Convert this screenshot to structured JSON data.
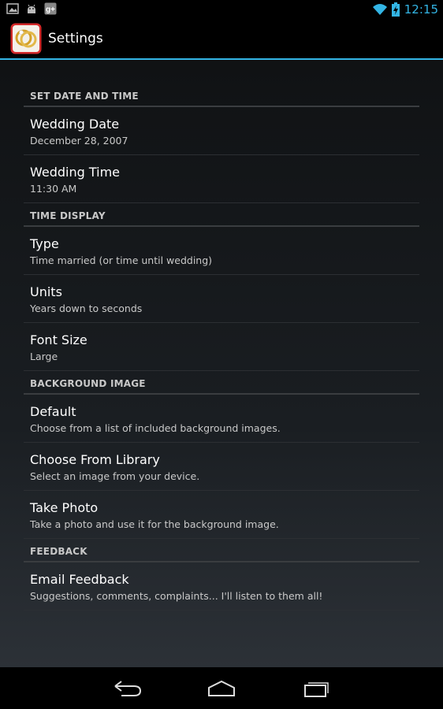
{
  "status_bar": {
    "time": "12:15",
    "notification_icons": [
      "gallery-icon",
      "android-icon",
      "google-plus-icon"
    ],
    "system_icons": [
      "wifi-icon",
      "battery-charging-icon"
    ],
    "gplus_glyph": "g+"
  },
  "action_bar": {
    "title": "Settings",
    "app_icon": "wedding-rings-icon",
    "accent_color": "#33b5e5"
  },
  "sections": [
    {
      "header": "SET DATE AND TIME",
      "items": [
        {
          "title": "Wedding Date",
          "summary": "December 28, 2007"
        },
        {
          "title": "Wedding Time",
          "summary": "11:30 AM"
        }
      ]
    },
    {
      "header": "TIME DISPLAY",
      "items": [
        {
          "title": "Type",
          "summary": "Time married (or time until wedding)"
        },
        {
          "title": "Units",
          "summary": "Years down to seconds"
        },
        {
          "title": "Font Size",
          "summary": "Large"
        }
      ]
    },
    {
      "header": "BACKGROUND IMAGE",
      "items": [
        {
          "title": "Default",
          "summary": "Choose from a list of included background images."
        },
        {
          "title": "Choose From Library",
          "summary": "Select an image from your device."
        },
        {
          "title": "Take Photo",
          "summary": "Take a photo and use it for the background image."
        }
      ]
    },
    {
      "header": "FEEDBACK",
      "items": [
        {
          "title": "Email Feedback",
          "summary": "Suggestions, comments, complaints... I'll listen to them all!"
        }
      ]
    }
  ],
  "nav_bar": {
    "buttons": [
      "back-icon",
      "home-icon",
      "recent-apps-icon"
    ]
  }
}
